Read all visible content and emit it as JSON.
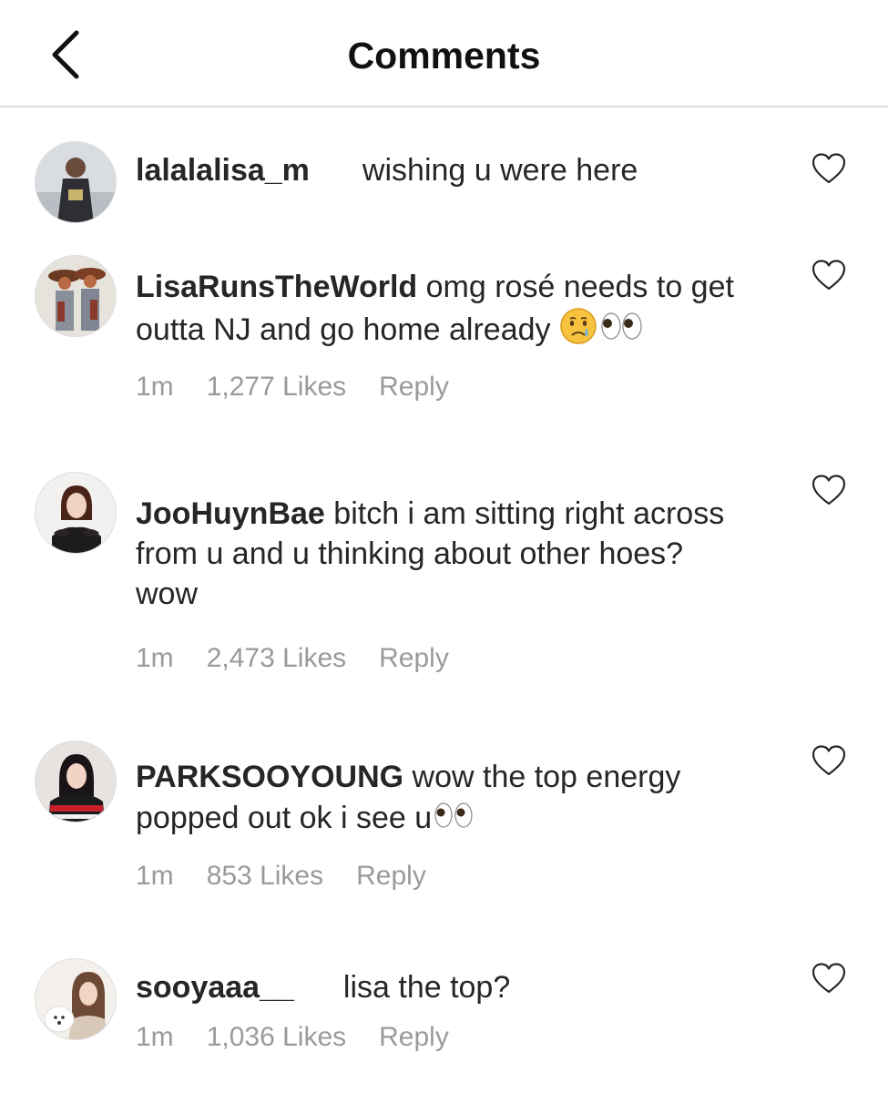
{
  "header": {
    "title": "Comments",
    "back_icon": "chevron-left-icon"
  },
  "comments": [
    {
      "username": "lalalalisa_m",
      "text": "wishing u were here"
    },
    {
      "username": "LisaRunsTheWorld",
      "text": "omg rosé needs to get",
      "text2": "outta NJ and go home already",
      "emojis": [
        "crying-face-emoji",
        "eyes-emoji"
      ],
      "time": "1m",
      "likes": "1,277 Likes",
      "reply": "Reply"
    },
    {
      "username": "JooHuynBae",
      "text": "bitch i am sitting right across",
      "text2": "from u and u thinking about other hoes?",
      "text3": "wow",
      "time": "1m",
      "likes": "2,473 Likes",
      "reply": "Reply"
    },
    {
      "username": "PARKSOOYOUNG",
      "text": "wow the top energy",
      "text2": "popped out ok i see u",
      "emojis": [
        "eyes-emoji"
      ],
      "time": "1m",
      "likes": "853 Likes",
      "reply": "Reply"
    },
    {
      "username": "sooyaaa__",
      "text": "lisa the top?",
      "time": "1m",
      "likes": "1,036 Likes",
      "reply": "Reply"
    }
  ],
  "colors": {
    "text": "#262626",
    "meta": "#9a9a9a",
    "divider": "#dbdbdb",
    "heart_stroke": "#262626"
  }
}
